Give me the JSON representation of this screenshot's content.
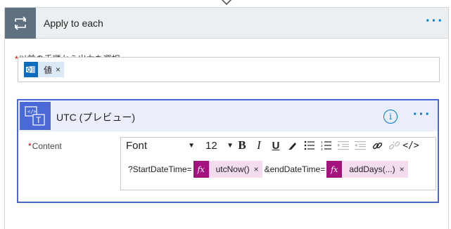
{
  "outer": {
    "title": "Apply to each",
    "more_label": "···",
    "select_required": "*",
    "select_label": "以前の手順から出力を選択",
    "selected_token": {
      "label": "値",
      "close": "×",
      "icon": "outlook-icon"
    }
  },
  "inner": {
    "title": "UTC (プレビュー)",
    "info_label": "i",
    "more_label": "···",
    "content_required": "*",
    "content_label": "Content",
    "toolbar": {
      "font_value": "Font",
      "size_value": "12",
      "caret": "▼",
      "bold": "B",
      "italic": "I",
      "underline": "U",
      "code": "</>"
    },
    "expression": {
      "text1": "?StartDateTime=",
      "token1": {
        "label": "utcNow()",
        "close": "×",
        "icon": "fx"
      },
      "text2": "&endDateTime=",
      "token2": {
        "label": "addDays(...)",
        "close": "×",
        "icon": "fx"
      }
    }
  },
  "colors": {
    "accent": "#0078d4",
    "loop_header": "#5f7180",
    "action_accent": "#4a68d6",
    "expression_token": "#a4127e"
  }
}
